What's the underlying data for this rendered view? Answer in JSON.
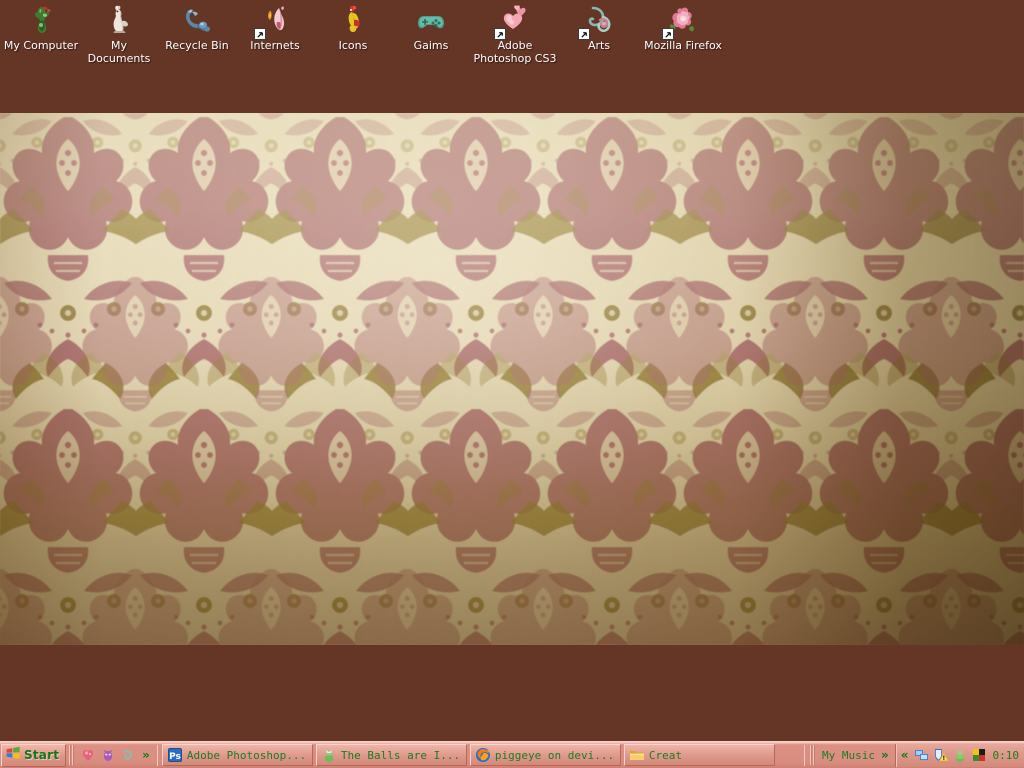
{
  "desktop": {
    "background_color": "#653526",
    "wallpaper": {
      "name": "damask-floral-wallpaper",
      "description": "Rose and olive-gold damask floral pattern",
      "colors": {
        "cream": "#ece2c4",
        "rose": "#a9656f",
        "crimson": "#9d3a46",
        "olive_gold": "#8a7322",
        "pink_highlight": "#d9a3b0"
      }
    },
    "icons": [
      {
        "label": "My Computer",
        "icon": "my-computer-icon",
        "shortcut": false
      },
      {
        "label": "My Documents",
        "icon": "my-documents-icon",
        "shortcut": false
      },
      {
        "label": "Recycle Bin",
        "icon": "recycle-bin-icon",
        "shortcut": false
      },
      {
        "label": "Internets",
        "icon": "internets-icon",
        "shortcut": true
      },
      {
        "label": "Icons",
        "icon": "icons-folder-icon",
        "shortcut": false
      },
      {
        "label": "Gaims",
        "icon": "gaims-gamepad-icon",
        "shortcut": false
      },
      {
        "label": "Adobe Photoshop CS3",
        "icon": "adobe-photoshop-hearts-icon",
        "shortcut": true
      },
      {
        "label": "Arts",
        "icon": "arts-swirl-icon",
        "shortcut": true
      },
      {
        "label": "Mozilla Firefox",
        "icon": "mozilla-firefox-rose-icon",
        "shortcut": true
      }
    ]
  },
  "taskbar": {
    "background_color": "#d98d80",
    "accent_text_color": "#1a7d22",
    "start": {
      "label": "Start",
      "icon": "windows-flag-icon"
    },
    "quick_launch": {
      "icons": [
        {
          "name": "quicklaunch-icon-1"
        },
        {
          "name": "quicklaunch-icon-2"
        },
        {
          "name": "quicklaunch-icon-3"
        }
      ],
      "overflow_label": "»"
    },
    "windows": [
      {
        "label": "Adobe Photoshop...",
        "icon": "photoshop-ps-icon"
      },
      {
        "label": "The Balls are I...",
        "icon": "messenger-person-icon"
      },
      {
        "label": "piggeye on devi...",
        "icon": "firefox-icon"
      },
      {
        "label": "Creat",
        "icon": "folder-icon"
      }
    ],
    "music_toolbar": {
      "label": "My Music",
      "overflow_label": "»"
    },
    "tray": {
      "expand_label": "«",
      "icons": [
        {
          "name": "network-connections-icon"
        },
        {
          "name": "security-alert-shield-icon"
        },
        {
          "name": "messenger-status-icon"
        },
        {
          "name": "color-squares-icon"
        }
      ],
      "clock": "0:10"
    }
  }
}
